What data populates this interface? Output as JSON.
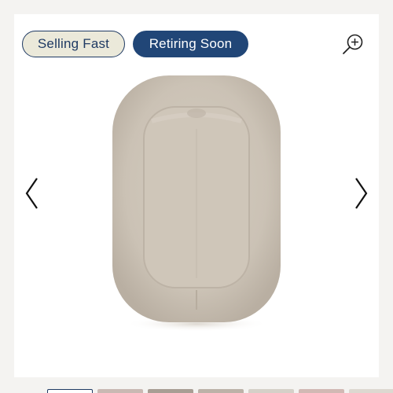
{
  "gallery": {
    "badges": {
      "selling_fast": "Selling Fast",
      "retiring_soon": "Retiring Soon"
    },
    "icons": {
      "zoom": "zoom-in-icon",
      "prev": "chevron-left-icon",
      "next": "chevron-right-icon"
    },
    "product_image": "baby lounger, oat color",
    "thumbnail_count": 7,
    "active_thumbnail": 1
  },
  "colors": {
    "navy": "#214677",
    "badge_cream": "#ebe9da",
    "lounger": "#ccc3b6"
  }
}
